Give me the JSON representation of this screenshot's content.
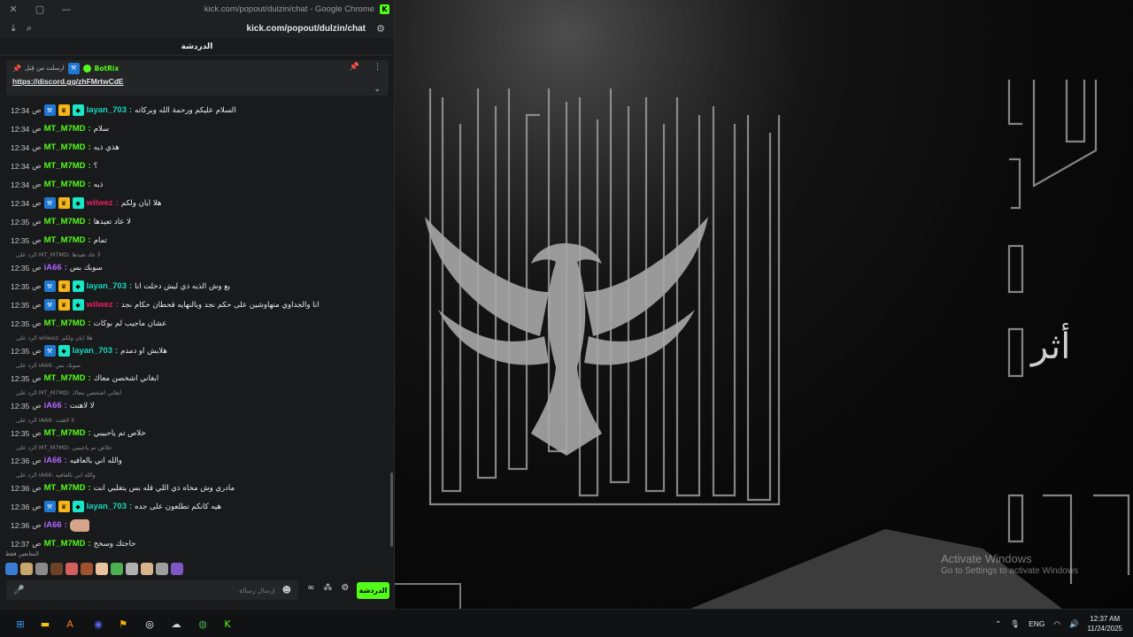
{
  "window": {
    "title": "kick.com/popout/dulzin/chat - Google Chrome",
    "url": "kick.com/popout/dulzin/chat",
    "controls": [
      "close-icon",
      "maximize-icon",
      "minimize-icon"
    ]
  },
  "chat": {
    "header": "الدردشة",
    "pinned": {
      "by_label": "ارسلت من قِبل",
      "bot_name": "BotRix",
      "link": "https://discord.gg/zhFMrtwCdE"
    },
    "messages": [
      {
        "time": "12:34",
        "ampm": "ص",
        "user": "layan_703",
        "color": "#18d7c0",
        "badges": [
          "b-blue",
          "b-gold",
          "b-cyan"
        ],
        "text": "السلام عليكم ورحمة الله وبركاته",
        "reply": ""
      },
      {
        "time": "12:34",
        "ampm": "ص",
        "user": "MT_M7MD",
        "color": "#53fc18",
        "badges": [],
        "text": "سلام",
        "reply": ""
      },
      {
        "time": "12:34",
        "ampm": "ص",
        "user": "MT_M7MD",
        "color": "#53fc18",
        "badges": [],
        "text": "هذي ذيه",
        "reply": ""
      },
      {
        "time": "12:34",
        "ampm": "ص",
        "user": "MT_M7MD",
        "color": "#53fc18",
        "badges": [],
        "text": "؟",
        "reply": ""
      },
      {
        "time": "12:34",
        "ampm": "ص",
        "user": "MT_M7MD",
        "color": "#53fc18",
        "badges": [],
        "text": "ذيه",
        "reply": ""
      },
      {
        "time": "12:34",
        "ampm": "ص",
        "user": "wilwez",
        "color": "#e91e63",
        "badges": [
          "b-blue",
          "b-gold",
          "b-cyan"
        ],
        "text": "هلا ايان ولكم",
        "reply": ""
      },
      {
        "time": "12:35",
        "ampm": "ص",
        "user": "MT_M7MD",
        "color": "#53fc18",
        "badges": [],
        "text": "لا عاد تعيدها",
        "reply": ""
      },
      {
        "time": "12:35",
        "ampm": "ص",
        "user": "MT_M7MD",
        "color": "#53fc18",
        "badges": [],
        "text": "تمام",
        "reply": ""
      },
      {
        "time": "12:35",
        "ampm": "ص",
        "user": "iA66",
        "color": "#b464ff",
        "badges": [],
        "text": "سوبك بس",
        "reply": "الرد على MT_M7MD: لا عاد تعيدها"
      },
      {
        "time": "12:35",
        "ampm": "ص",
        "user": "layan_703",
        "color": "#18d7c0",
        "badges": [
          "b-blue",
          "b-gold",
          "b-cyan"
        ],
        "text": "يع وش الذيه ذي ليش دخلت انا",
        "reply": ""
      },
      {
        "time": "12:35",
        "ampm": "ص",
        "user": "wilwez",
        "color": "#e91e63",
        "badges": [
          "b-blue",
          "b-gold",
          "b-cyan"
        ],
        "text": "انا والجداوي متهاوشين على حكم نجد وبالنهايه قحطان حكام نجد",
        "reply": ""
      },
      {
        "time": "12:35",
        "ampm": "ص",
        "user": "MT_M7MD",
        "color": "#53fc18",
        "badges": [],
        "text": "عشان ماجيب لم بوكات",
        "reply": ""
      },
      {
        "time": "12:35",
        "ampm": "ص",
        "user": "layan_703",
        "color": "#18d7c0",
        "badges": [
          "b-blue",
          "b-cyan"
        ],
        "text": "هلابش او دمدم",
        "reply": "الرد على wilwez: هلا ايان ولكم"
      },
      {
        "time": "12:35",
        "ampm": "ص",
        "user": "MT_M7MD",
        "color": "#53fc18",
        "badges": [],
        "text": "ابغاني اشخصن معاك",
        "reply": "الرد على iA66: سوبك بس"
      },
      {
        "time": "12:35",
        "ampm": "ص",
        "user": "iA66",
        "color": "#b464ff",
        "badges": [],
        "text": "لا لاهنت",
        "reply": "الرد على MT_M7MD: ابغاني اشخصن معاك"
      },
      {
        "time": "12:35",
        "ampm": "ص",
        "user": "MT_M7MD",
        "color": "#53fc18",
        "badges": [],
        "text": "خلاص تم ياحبيبي",
        "reply": "الرد على iA66: لا لاهنت"
      },
      {
        "time": "12:36",
        "ampm": "ص",
        "user": "iA66",
        "color": "#b464ff",
        "badges": [],
        "text": "والله اني بالعافيه",
        "reply": "الرد على MT_M7MD: خلاص تم ياحبيبي"
      },
      {
        "time": "12:36",
        "ampm": "ص",
        "user": "MT_M7MD",
        "color": "#53fc18",
        "badges": [],
        "text": "مادري وش مخاه ذي اللي قله بس يتغلبي انت",
        "reply": "الرد على iA66: والله اني بالعافيه"
      },
      {
        "time": "12:36",
        "ampm": "ص",
        "user": "layan_703",
        "color": "#18d7c0",
        "badges": [
          "b-blue",
          "b-gold",
          "b-cyan"
        ],
        "text": "هيه كانكم تطلعون على جده",
        "reply": ""
      },
      {
        "time": "12:36",
        "ampm": "ص",
        "user": "iA66",
        "color": "#b464ff",
        "badges": [],
        "text": "",
        "reply": "",
        "emote": "hand"
      },
      {
        "time": "12:37",
        "ampm": "ص",
        "user": "MT_M7MD",
        "color": "#53fc18",
        "badges": [],
        "text": "حاجتك وسخخ",
        "reply": ""
      }
    ],
    "emote_label": "المتابعين فقط",
    "emotes": [
      "#3a7bd5",
      "#c9a66b",
      "#8a8a8a",
      "#6b4226",
      "#d35f5f",
      "#a0522d",
      "#e8c39e",
      "#4caf50",
      "#b0b0b0",
      "#d9b38c",
      "#9e9e9e",
      "#7e57c2"
    ],
    "input_placeholder": "إرسال رسالة",
    "send_label": "الدردشة"
  },
  "desktop": {
    "watermark_title": "Activate Windows",
    "watermark_sub": "Go to Settings to activate Windows"
  },
  "taskbar": {
    "apps": [
      {
        "name": "start-button",
        "glyph": "⊞",
        "color": "#3b9cff"
      },
      {
        "name": "file-explorer-icon",
        "glyph": "▬",
        "color": "#f5c518"
      },
      {
        "name": "app-icon-a",
        "glyph": "A",
        "color": "#ff7a1a"
      },
      {
        "name": "discord-icon",
        "glyph": "◉",
        "color": "#5865f2"
      },
      {
        "name": "app-icon-b",
        "glyph": "⚑",
        "color": "#ffb300"
      },
      {
        "name": "obs-icon",
        "glyph": "◎",
        "color": "#ffffff"
      },
      {
        "name": "app-icon-c",
        "glyph": "☁",
        "color": "#cfd8dc"
      },
      {
        "name": "chrome-icon",
        "glyph": "◍",
        "color": "#4caf50"
      },
      {
        "name": "kick-icon",
        "glyph": "K",
        "color": "#53fc18"
      }
    ],
    "lang": "ENG",
    "time": "12:37 AM",
    "date": "11/24/2025"
  }
}
